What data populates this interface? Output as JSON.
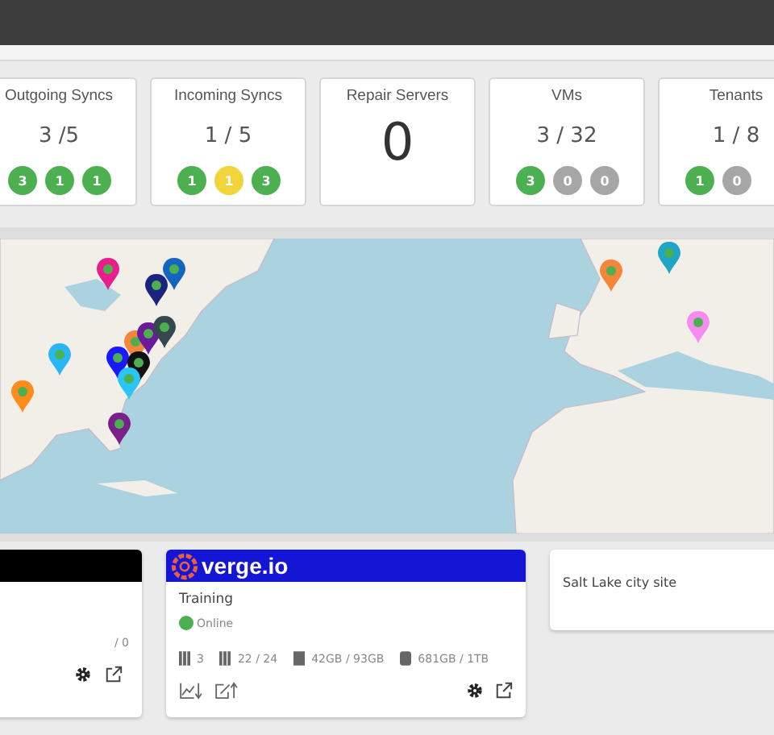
{
  "stats": [
    {
      "kind": "ratio",
      "title": "Outgoing Syncs",
      "value": "3 /5",
      "badges": [
        {
          "count": "3",
          "color": "#4caf50"
        },
        {
          "count": "1",
          "color": "#4caf50"
        },
        {
          "count": "1",
          "color": "#4caf50"
        }
      ]
    },
    {
      "kind": "ratio",
      "title": "Incoming Syncs",
      "value": "1 / 5",
      "badges": [
        {
          "count": "1",
          "color": "#4caf50"
        },
        {
          "count": "1",
          "color": "#f0d43a"
        },
        {
          "count": "3",
          "color": "#4caf50"
        }
      ]
    },
    {
      "kind": "count",
      "title": "Repair Servers",
      "value": "0"
    },
    {
      "kind": "ratio",
      "title": "VMs",
      "value": "3 / 32",
      "badges": [
        {
          "count": "3",
          "color": "#4caf50"
        },
        {
          "count": "0",
          "color": "#a6a6a6"
        },
        {
          "count": "0",
          "color": "#a6a6a6"
        }
      ]
    },
    {
      "kind": "ratio",
      "title": "Tenants",
      "value": "1 / 8",
      "badges": [
        {
          "count": "1",
          "color": "#4caf50"
        },
        {
          "count": "0",
          "color": "#a6a6a6"
        }
      ]
    }
  ],
  "sites": [
    {
      "kind": "partial",
      "stat": "/ 0"
    },
    {
      "kind": "full",
      "logo_text": "verge.io",
      "name": "Training",
      "status": {
        "label": "Online",
        "color": "#4caf50"
      },
      "metrics": [
        "3",
        "22 / 24",
        "42GB / 93GB",
        "681GB / 1TB"
      ]
    },
    {
      "kind": "plain",
      "name": "Salt Lake city site"
    }
  ]
}
